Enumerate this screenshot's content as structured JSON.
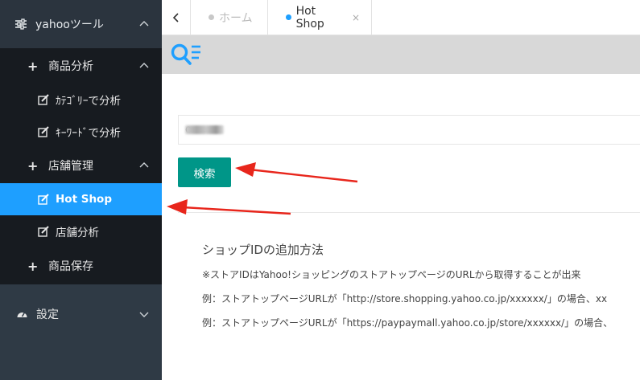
{
  "sidebar": {
    "top_label": "yahooツール",
    "groups": [
      {
        "label": "商品分析",
        "items": [
          {
            "label": "ｶﾃｺﾞﾘｰで分析"
          },
          {
            "label": "ｷｰﾜｰﾄﾞで分析"
          }
        ]
      },
      {
        "label": "店舗管理",
        "items": [
          {
            "label": "Hot Shop",
            "active": true
          },
          {
            "label": "店舗分析"
          }
        ]
      },
      {
        "label": "商品保存",
        "items": []
      }
    ],
    "settings_label": "設定"
  },
  "tabs": [
    {
      "label": "ホーム",
      "active": false
    },
    {
      "label": "Hot Shop",
      "active": true,
      "close": "×"
    }
  ],
  "search": {
    "value": "o",
    "button_label": "検索"
  },
  "info": {
    "title": "ショップIDの追加方法",
    "lines": [
      "※ストアIDはYahoo!ショッピングのストアトップページのURLから取得することが出来",
      "例：ストアトップページURLが「http://store.shopping.yahoo.co.jp/xxxxxx/」の場合、xx",
      "例：ストアトップページURLが「https://paypaymall.yahoo.co.jp/store/xxxxxx/」の場合、"
    ]
  },
  "colors": {
    "sidebar_bg": "#2f3a45",
    "submenu_bg": "#171b20",
    "active": "#1e9fff",
    "button": "#009688",
    "toolbar": "#d8d8d8",
    "arrow": "#e8261c"
  },
  "icons": [
    "sliders-icon",
    "chevron-up-icon",
    "plus-icon",
    "edit-icon",
    "dashboard-icon",
    "chevron-down-icon",
    "back-icon",
    "search-list-icon",
    "close-icon",
    "arrow-annotation"
  ]
}
